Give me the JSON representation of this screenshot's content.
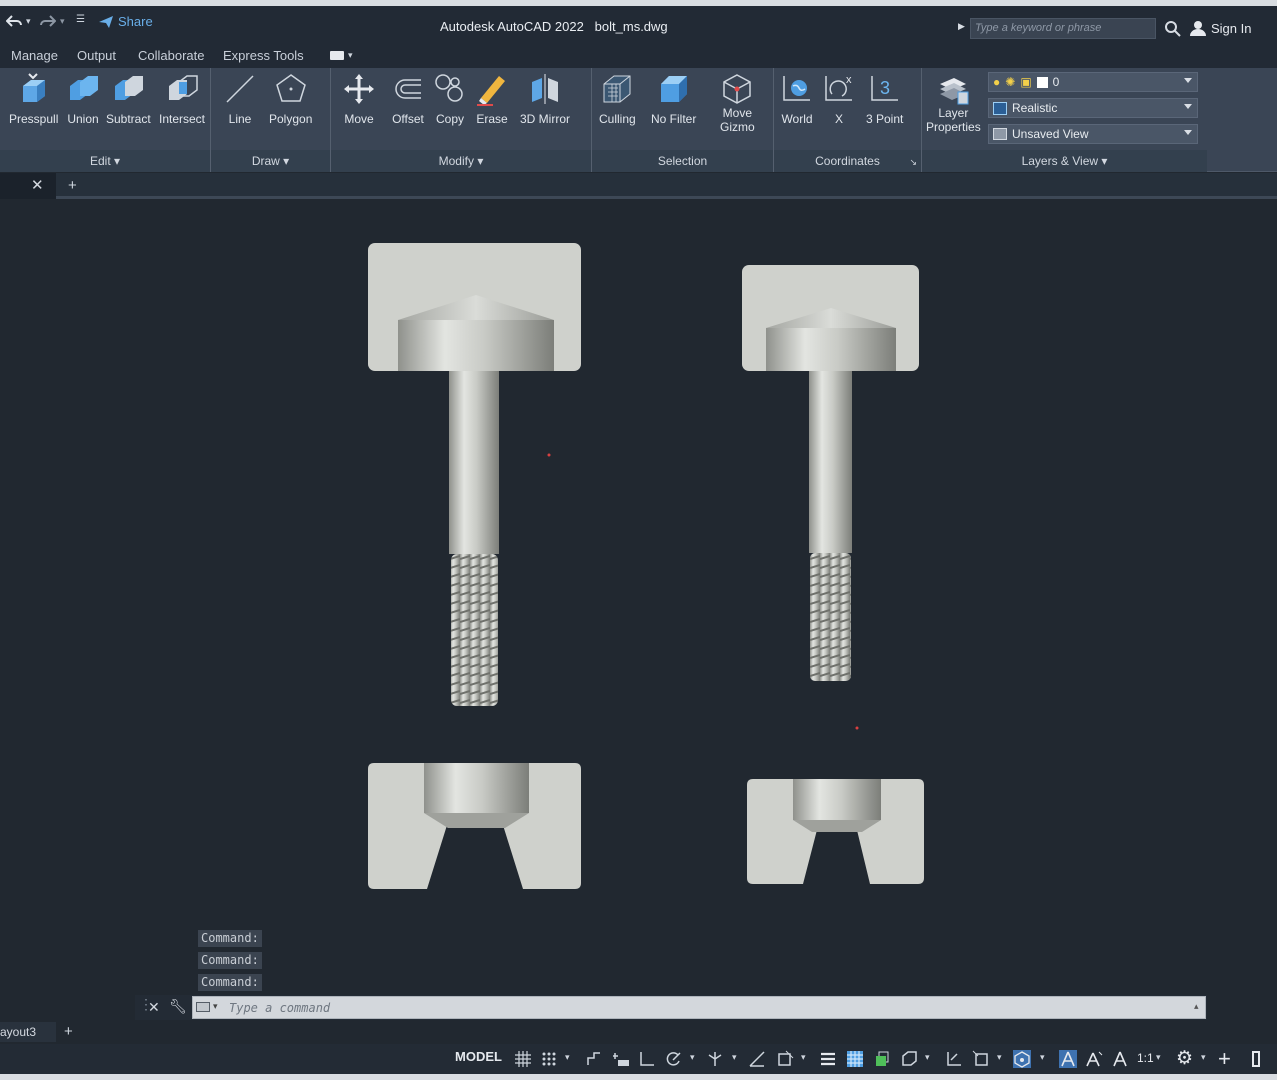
{
  "titlebar": {
    "share_label": "Share",
    "app_title": "Autodesk AutoCAD 2022",
    "file_name": "bolt_ms.dwg",
    "search_placeholder": "Type a keyword or phrase",
    "signin_label": "Sign In"
  },
  "ribbon_tabs": [
    "Manage",
    "Output",
    "Collaborate",
    "Express Tools"
  ],
  "panels": {
    "edit": {
      "title": "Edit",
      "tools": [
        "Presspull",
        "Union",
        "Subtract",
        "Intersect"
      ]
    },
    "draw": {
      "title": "Draw",
      "tools": [
        "Line",
        "Polygon"
      ]
    },
    "modify": {
      "title": "Modify",
      "tools": [
        "Move",
        "Offset",
        "Copy",
        "Erase",
        "3D Mirror"
      ]
    },
    "selection": {
      "title": "Selection",
      "tools": [
        "Culling",
        "No Filter",
        "Move",
        "Gizmo"
      ]
    },
    "coordinates": {
      "title": "Coordinates",
      "tools": [
        "World",
        "X",
        "3 Point"
      ]
    },
    "layers": {
      "title": "Layers & View",
      "layer_properties_1": "Layer",
      "layer_properties_2": "Properties",
      "current_layer": "0",
      "visual_style": "Realistic",
      "named_view": "Unsaved View"
    }
  },
  "command": {
    "history": [
      "Command:",
      "Command:",
      "Command:"
    ],
    "placeholder": "Type a command"
  },
  "layout_tab": "ayout3",
  "status": {
    "model_label": "MODEL",
    "scale": "1:1"
  },
  "colors": {
    "accent": "#69aee8",
    "background": "#212830",
    "ribbon": "#3a4555",
    "part": "#cfd1cc"
  }
}
